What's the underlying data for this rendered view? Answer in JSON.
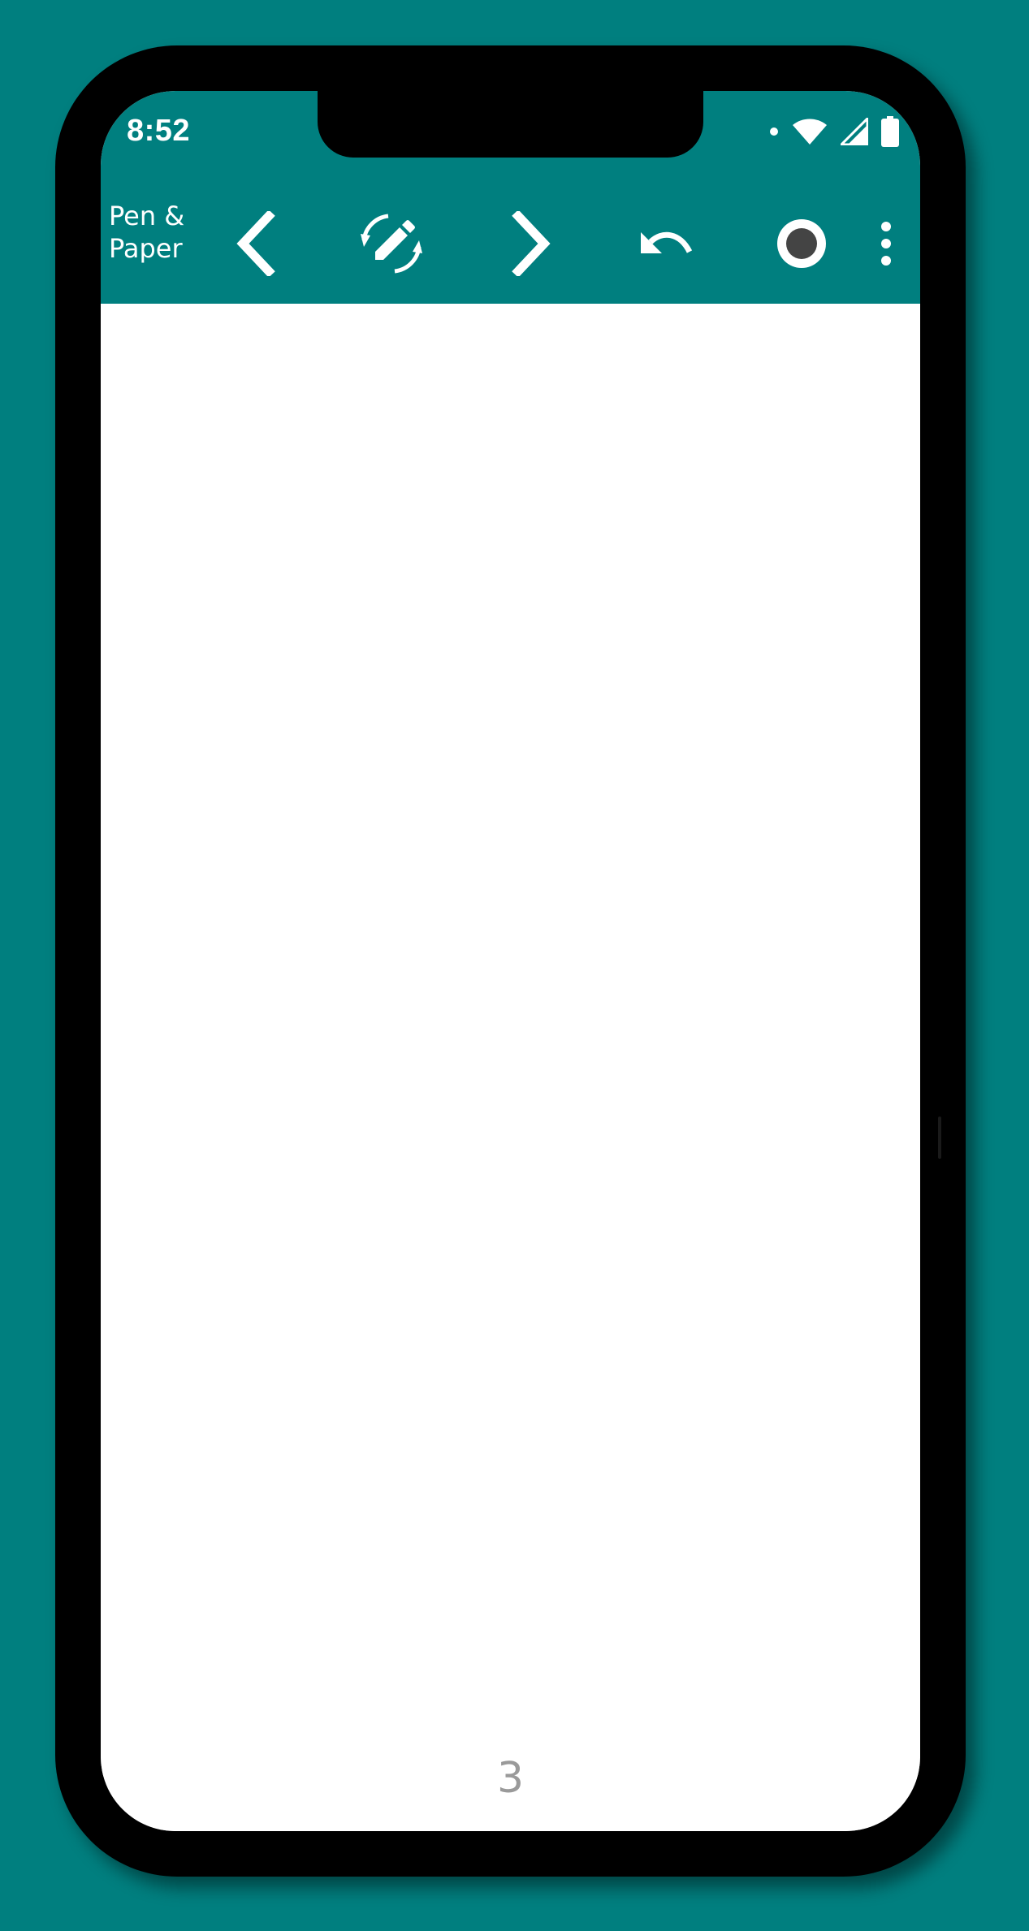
{
  "status_bar": {
    "time": "8:52",
    "icons": [
      "notification-dot-icon",
      "wifi-icon",
      "cell-signal-icon",
      "battery-icon"
    ]
  },
  "toolbar": {
    "app_title": "Pen &\nPaper",
    "buttons": [
      {
        "name": "previous-page",
        "icon": "chevron-left-icon"
      },
      {
        "name": "tool-switch",
        "icon": "pencil-cycle-icon"
      },
      {
        "name": "next-page",
        "icon": "chevron-right-icon"
      },
      {
        "name": "undo",
        "icon": "undo-icon"
      },
      {
        "name": "brush-color",
        "icon": "circle-dot-icon",
        "color": "#444444"
      },
      {
        "name": "more-options",
        "icon": "more-vertical-icon"
      }
    ]
  },
  "canvas": {
    "page_number": "3"
  },
  "colors": {
    "background": "#007f7f",
    "appbar": "#007f7f",
    "toolbar_icons": "#ffffff",
    "page_number": "#9a9a9a"
  }
}
